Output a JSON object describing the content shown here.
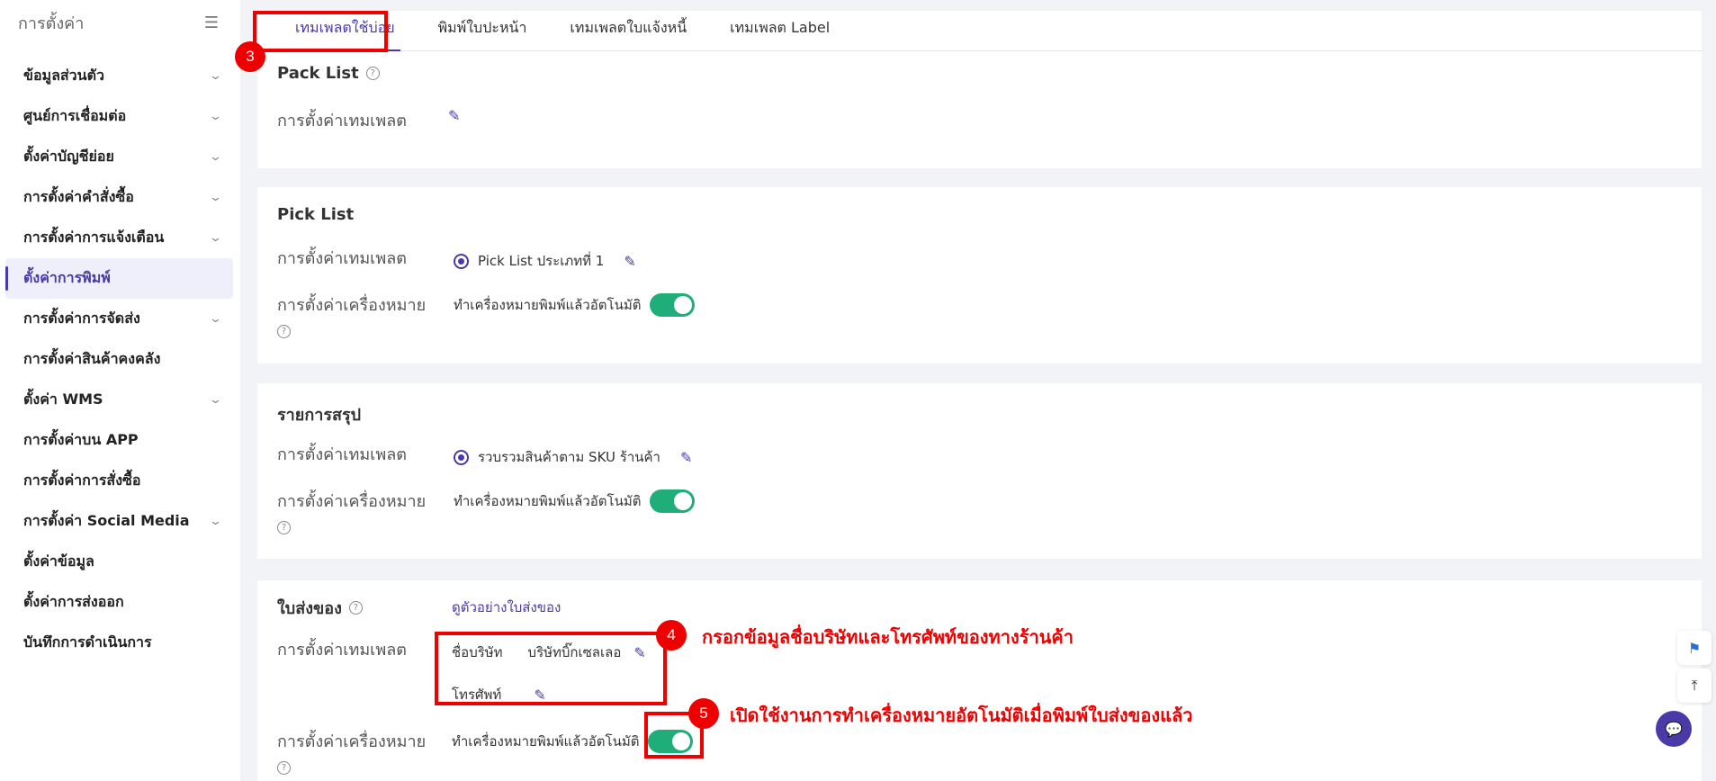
{
  "sidebar": {
    "title": "การตั้งค่า",
    "items": [
      {
        "label": "ข้อมูลส่วนตัว",
        "has_children": true
      },
      {
        "label": "ศูนย์การเชื่อมต่อ",
        "has_children": true
      },
      {
        "label": "ตั้งค่าบัญชีย่อย",
        "has_children": true
      },
      {
        "label": "การตั้งค่าคำสั่งซื้อ",
        "has_children": true
      },
      {
        "label": "การตั้งค่าการแจ้งเตือน",
        "has_children": true
      },
      {
        "label": "ตั้งค่าการพิมพ์",
        "has_children": false,
        "active": true
      },
      {
        "label": "การตั้งค่าการจัดส่ง",
        "has_children": true
      },
      {
        "label": "การตั้งค่าสินค้าคงคลัง",
        "has_children": false
      },
      {
        "label": "ตั้งค่า WMS",
        "has_children": true
      },
      {
        "label": "การตั้งค่าบน APP",
        "has_children": false
      },
      {
        "label": "การตั้งค่าการสั่งซื้อ",
        "has_children": false
      },
      {
        "label": "การตั้งค่า Social Media",
        "has_children": true
      },
      {
        "label": "ตั้งค่าข้อมูล",
        "has_children": false
      },
      {
        "label": "ตั้งค่าการส่งออก",
        "has_children": false
      },
      {
        "label": "บันทึกการดำเนินการ",
        "has_children": false
      }
    ]
  },
  "tabs": [
    "เทมเพลตใช้บ่อย",
    "พิมพ์ใบปะหน้า",
    "เทมเพลตใบแจ้งหนี้",
    "เทมเพลต Label"
  ],
  "sections": {
    "pack_list": {
      "title": "Pack List",
      "template_label": "การตั้งค่าเทมเพลต"
    },
    "pick_list": {
      "title": "Pick List",
      "template_label": "การตั้งค่าเทมเพลต",
      "template_value": "Pick List ประเภทที่ 1",
      "printer_label": "การตั้งค่าเครื่องหมาย",
      "printer_value": "ทำเครื่องหมายพิมพ์แล้วอัตโนมัติ"
    },
    "summary": {
      "title": "รายการสรุป",
      "template_label": "การตั้งค่าเทมเพลต",
      "template_value": "รวบรวมสินค้าตาม SKU ร้านค้า",
      "printer_label": "การตั้งค่าเครื่องหมาย",
      "printer_value": "ทำเครื่องหมายพิมพ์แล้วอัตโนมัติ"
    },
    "delivery_note": {
      "title": "ใบส่งของ",
      "preview_link": "ดูตัวอย่างใบส่งของ",
      "template_label": "การตั้งค่าเทมเพลต",
      "company_label": "ชื่อบริษัท",
      "company_value": "บริษัทบิ๊กเซลเลอ",
      "phone_label": "โทรศัพท์",
      "printer_label": "การตั้งค่าเครื่องหมาย",
      "printer_value": "ทำเครื่องหมายพิมพ์แล้วอัตโนมัติ"
    }
  },
  "annotations": {
    "step3": "3",
    "step4": "4",
    "step5": "5",
    "note4": "กรอกข้อมูลชื่อบริษัทและโทรศัพท์ของทางร้านค้า",
    "note5": "เปิดใช้งานการทำเครื่องหมายอัตโนมัติเมื่อพิมพ์ใบส่งของแล้ว"
  },
  "colors": {
    "accent": "#4a3aa8",
    "toggle_on": "#1fae7a",
    "annotation": "#e00000"
  }
}
